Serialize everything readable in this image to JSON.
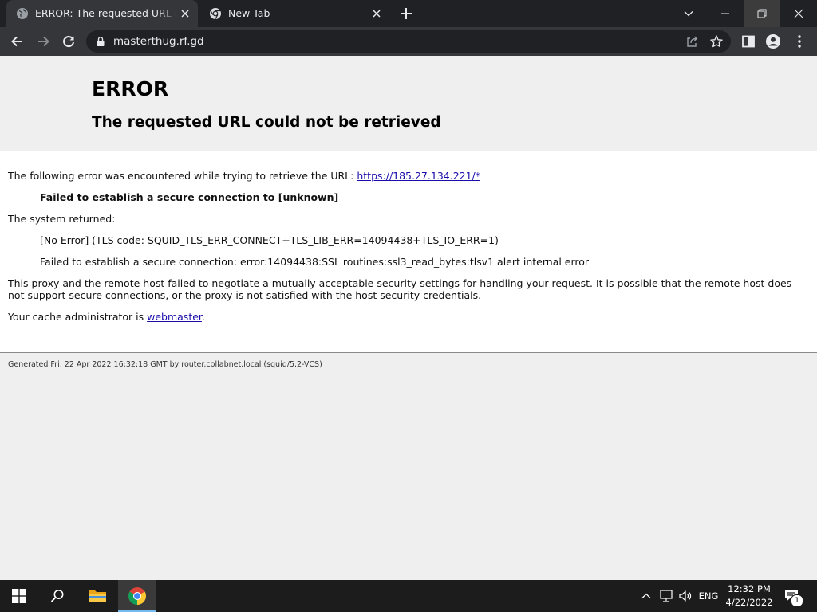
{
  "browser": {
    "tabs": [
      {
        "title": "ERROR: The requested URL could not be retrieved",
        "active": true
      },
      {
        "title": "New Tab",
        "active": false
      }
    ],
    "address": "masterthug.rf.gd"
  },
  "page": {
    "title": "ERROR",
    "subtitle": "The requested URL could not be retrieved",
    "intro": "The following error was encountered while trying to retrieve the URL: ",
    "url_link": "https://185.27.134.221/*",
    "error_bold": "Failed to establish a secure connection to [unknown]",
    "system_returned": "The system returned:",
    "tls_code": "[No Error] (TLS code: SQUID_TLS_ERR_CONNECT+TLS_LIB_ERR=14094438+TLS_IO_ERR=1)",
    "ssl_detail": "Failed to establish a secure connection: error:14094438:SSL routines:ssl3_read_bytes:tlsv1 alert internal error",
    "explanation": "This proxy and the remote host failed to negotiate a mutually acceptable security settings for handling your request. It is possible that the remote host does not support secure connections, or the proxy is not satisfied with the host security credentials.",
    "admin_prefix": "Your cache administrator is ",
    "admin_link": "webmaster",
    "admin_suffix": ".",
    "footer": "Generated Fri, 22 Apr 2022 16:32:18 GMT by router.collabnet.local (squid/5.2-VCS)"
  },
  "taskbar": {
    "language": "ENG",
    "time": "12:32 PM",
    "date": "4/22/2022",
    "notification_count": "1"
  },
  "colors": {
    "tab_strip": "#202124",
    "toolbar": "#35363a",
    "link": "#1a0dab",
    "taskbar": "#1c1c1c"
  }
}
